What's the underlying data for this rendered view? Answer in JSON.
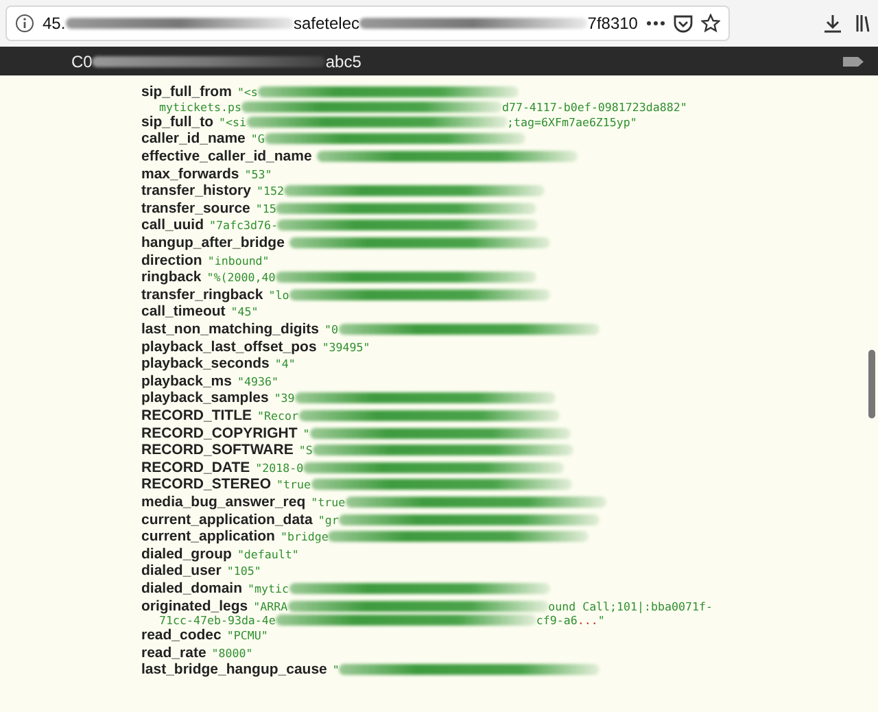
{
  "browser": {
    "url": [
      {
        "kind": "text",
        "text": "45."
      },
      {
        "kind": "redaction"
      },
      {
        "kind": "text",
        "text": "safetelec"
      },
      {
        "kind": "redaction"
      },
      {
        "kind": "text",
        "text": "7f8310"
      }
    ]
  },
  "tab_bar": {
    "title": [
      {
        "kind": "text",
        "text": "C0"
      },
      {
        "kind": "redaction"
      },
      {
        "kind": "text",
        "text": "abc5"
      }
    ]
  },
  "rows": [
    {
      "key": "sip_full_from",
      "lines": [
        [
          {
            "kind": "text",
            "text": "\"<s"
          },
          {
            "kind": "redaction"
          }
        ],
        [
          {
            "kind": "text",
            "text": "mytickets.ps"
          },
          {
            "kind": "redaction"
          },
          {
            "kind": "text",
            "text": "d77-4117-b0ef-0981723da882\""
          }
        ]
      ]
    },
    {
      "key": "sip_full_to",
      "lines": [
        [
          {
            "kind": "text",
            "text": "\"<si"
          },
          {
            "kind": "redaction"
          },
          {
            "kind": "text",
            "text": ";tag=6XFm7ae6Z15yp\""
          }
        ]
      ]
    },
    {
      "key": "caller_id_name",
      "lines": [
        [
          {
            "kind": "text",
            "text": "\"G"
          },
          {
            "kind": "redaction"
          }
        ]
      ]
    },
    {
      "key": "effective_caller_id_name",
      "lines": [
        [
          {
            "kind": "redaction"
          }
        ]
      ]
    },
    {
      "key": "max_forwards",
      "lines": [
        [
          {
            "kind": "text",
            "text": "\"53\""
          }
        ]
      ]
    },
    {
      "key": "transfer_history",
      "lines": [
        [
          {
            "kind": "text",
            "text": "\"152"
          },
          {
            "kind": "redaction"
          }
        ]
      ]
    },
    {
      "key": "transfer_source",
      "lines": [
        [
          {
            "kind": "text",
            "text": "\"15"
          },
          {
            "kind": "redaction"
          }
        ]
      ]
    },
    {
      "key": "call_uuid",
      "lines": [
        [
          {
            "kind": "text",
            "text": "\"7afc3d76-"
          },
          {
            "kind": "redaction"
          }
        ]
      ]
    },
    {
      "key": "hangup_after_bridge",
      "lines": [
        [
          {
            "kind": "redaction"
          }
        ]
      ]
    },
    {
      "key": "direction",
      "lines": [
        [
          {
            "kind": "text",
            "text": "\"inbound\""
          }
        ]
      ]
    },
    {
      "key": "ringback",
      "lines": [
        [
          {
            "kind": "text",
            "text": "\"%(2000,40"
          },
          {
            "kind": "redaction"
          }
        ]
      ]
    },
    {
      "key": "transfer_ringback",
      "lines": [
        [
          {
            "kind": "text",
            "text": "\"lo"
          },
          {
            "kind": "redaction"
          }
        ]
      ]
    },
    {
      "key": "call_timeout",
      "lines": [
        [
          {
            "kind": "text",
            "text": "\"45\""
          }
        ]
      ]
    },
    {
      "key": "last_non_matching_digits",
      "lines": [
        [
          {
            "kind": "text",
            "text": "\"0"
          },
          {
            "kind": "redaction"
          }
        ]
      ]
    },
    {
      "key": "playback_last_offset_pos",
      "lines": [
        [
          {
            "kind": "text",
            "text": "\"39495\""
          }
        ]
      ]
    },
    {
      "key": "playback_seconds",
      "lines": [
        [
          {
            "kind": "text",
            "text": "\"4\""
          }
        ]
      ]
    },
    {
      "key": "playback_ms",
      "lines": [
        [
          {
            "kind": "text",
            "text": "\"4936\""
          }
        ]
      ]
    },
    {
      "key": "playback_samples",
      "lines": [
        [
          {
            "kind": "text",
            "text": "\"39"
          },
          {
            "kind": "redaction"
          }
        ]
      ]
    },
    {
      "key": "RECORD_TITLE",
      "lines": [
        [
          {
            "kind": "text",
            "text": "\"Recor"
          },
          {
            "kind": "redaction"
          }
        ]
      ]
    },
    {
      "key": "RECORD_COPYRIGHT",
      "lines": [
        [
          {
            "kind": "text",
            "text": "\""
          },
          {
            "kind": "redaction"
          }
        ]
      ]
    },
    {
      "key": "RECORD_SOFTWARE",
      "lines": [
        [
          {
            "kind": "text",
            "text": "\"S"
          },
          {
            "kind": "redaction"
          }
        ]
      ]
    },
    {
      "key": "RECORD_DATE",
      "lines": [
        [
          {
            "kind": "text",
            "text": "\"2018-0"
          },
          {
            "kind": "redaction"
          }
        ]
      ]
    },
    {
      "key": "RECORD_STEREO",
      "lines": [
        [
          {
            "kind": "text",
            "text": "\"true"
          },
          {
            "kind": "redaction"
          }
        ]
      ]
    },
    {
      "key": "media_bug_answer_req",
      "lines": [
        [
          {
            "kind": "text",
            "text": "\"true"
          },
          {
            "kind": "redaction"
          }
        ]
      ]
    },
    {
      "key": "current_application_data",
      "lines": [
        [
          {
            "kind": "text",
            "text": "\"gr"
          },
          {
            "kind": "redaction"
          }
        ]
      ]
    },
    {
      "key": "current_application",
      "lines": [
        [
          {
            "kind": "text",
            "text": "\"bridge"
          },
          {
            "kind": "redaction"
          }
        ]
      ]
    },
    {
      "key": "dialed_group",
      "lines": [
        [
          {
            "kind": "text",
            "text": "\"default\""
          }
        ]
      ]
    },
    {
      "key": "dialed_user",
      "lines": [
        [
          {
            "kind": "text",
            "text": "\"105\""
          }
        ]
      ]
    },
    {
      "key": "dialed_domain",
      "lines": [
        [
          {
            "kind": "text",
            "text": "\"mytic"
          },
          {
            "kind": "redaction"
          }
        ]
      ]
    },
    {
      "key": "originated_legs",
      "lines": [
        [
          {
            "kind": "text",
            "text": "\"ARRA"
          },
          {
            "kind": "redaction"
          },
          {
            "kind": "text",
            "text": "ound Call;101|:bba0071f-"
          }
        ],
        [
          {
            "kind": "text",
            "text": "71cc-47eb-93da-4e"
          },
          {
            "kind": "redaction"
          },
          {
            "kind": "text",
            "text": "cf9-a6"
          },
          {
            "kind": "ellipsis",
            "text": "..."
          },
          {
            "kind": "text",
            "text": "\""
          }
        ]
      ]
    },
    {
      "key": "read_codec",
      "lines": [
        [
          {
            "kind": "text",
            "text": "\"PCMU\""
          }
        ]
      ]
    },
    {
      "key": "read_rate",
      "lines": [
        [
          {
            "kind": "text",
            "text": "\"8000\""
          }
        ]
      ]
    },
    {
      "key": "last_bridge_hangup_cause",
      "lines": [
        [
          {
            "kind": "text",
            "text": "\""
          },
          {
            "kind": "redaction"
          }
        ]
      ]
    }
  ]
}
